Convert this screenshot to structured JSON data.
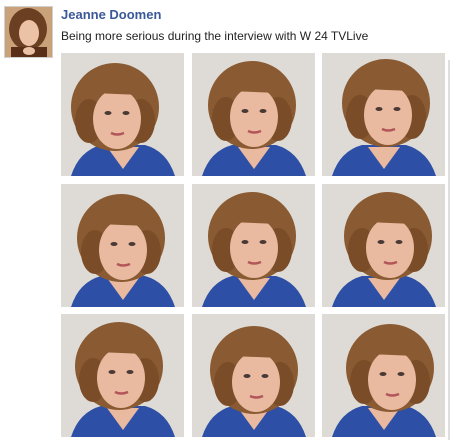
{
  "post": {
    "author": "Jeanne Doomen",
    "message": "Being more serious during the interview with W 24 TVLive"
  },
  "photos": [
    {
      "pose": "left-tilt"
    },
    {
      "pose": "frontal-look-right"
    },
    {
      "pose": "look-up"
    },
    {
      "pose": "frontal"
    },
    {
      "pose": "frontal-slight-smile"
    },
    {
      "pose": "look-left"
    },
    {
      "pose": "look-up-frontal"
    },
    {
      "pose": "tilt-down"
    },
    {
      "pose": "side-look-left"
    }
  ],
  "colors": {
    "link": "#3b5998",
    "hair": "#8a5a32",
    "jacket": "#2e4fa6",
    "skin": "#e9b9a0",
    "background": "#e3e1dc"
  }
}
